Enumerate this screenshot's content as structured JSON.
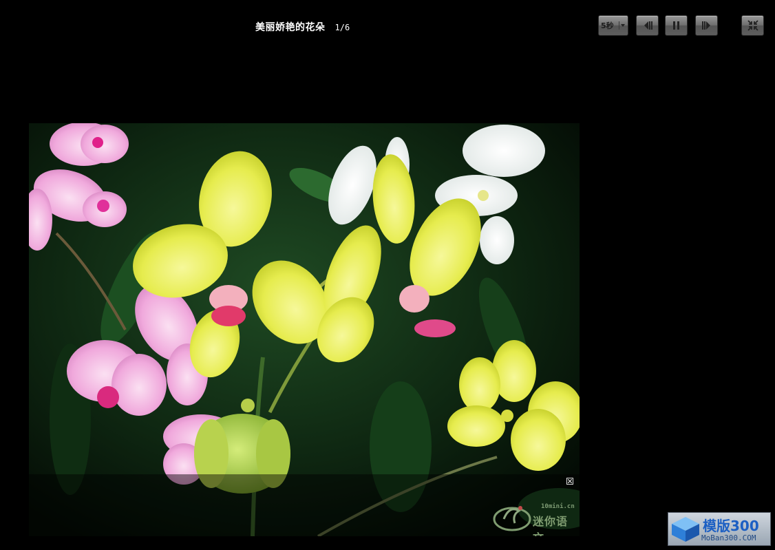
{
  "slideshow": {
    "title": "美丽娇艳的花朵",
    "counter": "1/6"
  },
  "controls": {
    "interval": "5秒",
    "icons": {
      "interval_dropdown": "chevron-down-icon",
      "prev": "skip-previous-icon",
      "pause": "pause-icon",
      "next": "skip-next-icon",
      "exit": "collapse-fullscreen-icon"
    }
  },
  "photo": {
    "close_icon": "close-icon",
    "watermark": {
      "url": "10mini.cn",
      "name": "迷你语文"
    }
  },
  "site_badge": {
    "name": "模版300",
    "domain": "MoBan300.COM"
  },
  "colors": {
    "background": "#000000",
    "button_light": "#9a9a9a",
    "button_dark": "#555555",
    "badge_text": "#1c5fc3"
  }
}
